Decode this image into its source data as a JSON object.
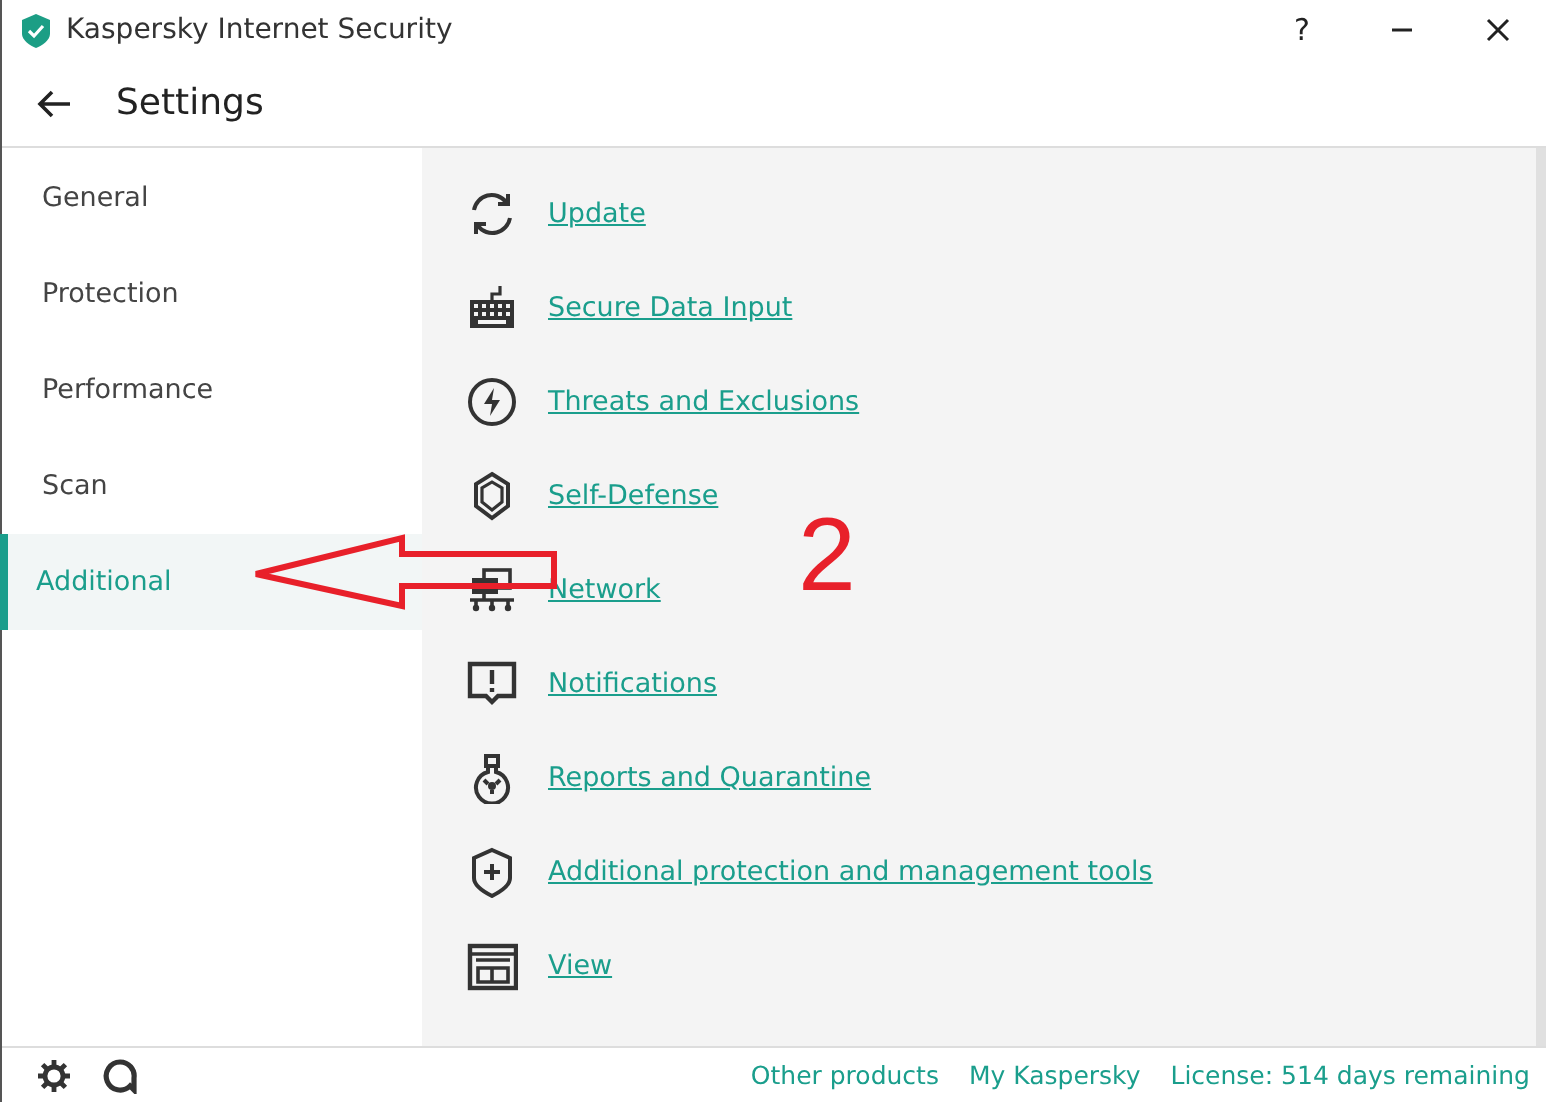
{
  "window": {
    "title": "Kaspersky Internet Security",
    "buttons": [
      "?"
    ]
  },
  "header": {
    "title": "Settings"
  },
  "sidebar": {
    "items": [
      {
        "label": "General",
        "selected": false
      },
      {
        "label": "Protection",
        "selected": false
      },
      {
        "label": "Performance",
        "selected": false
      },
      {
        "label": "Scan",
        "selected": false
      },
      {
        "label": "Additional",
        "selected": true
      }
    ]
  },
  "content": {
    "links": [
      "Update",
      "Secure Data Input",
      "Threats and Exclusions",
      "Self-Defense",
      "Network",
      "Notifications",
      "Reports and Quarantine",
      "Additional protection and management tools",
      "View"
    ]
  },
  "footer": {
    "links": [
      "Other products",
      "My Kaspersky",
      "License: 514 days remaining"
    ]
  },
  "annotation": {
    "label": "2"
  }
}
